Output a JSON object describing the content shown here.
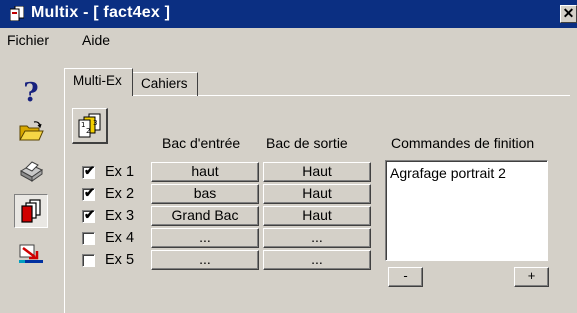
{
  "window": {
    "title": "Multix - [ fact4ex ]",
    "close_glyph": "✕",
    "titlebar_color": "#0b2f82"
  },
  "menu": {
    "items": [
      "Fichier",
      "Aide"
    ]
  },
  "toolbar": {
    "help_glyph": "?",
    "icons": [
      "help-icon",
      "open-folder-icon",
      "printer-icon",
      "multi-document-icon",
      "export-arrow-icon"
    ]
  },
  "tabs": [
    "Multi-Ex",
    "Cahiers"
  ],
  "columns": {
    "input_bin": "Bac d'entrée",
    "output_bin": "Bac de sortie",
    "finishing": "Commandes de finition"
  },
  "rows": [
    {
      "label": "Ex 1",
      "checked": true,
      "input_bin": "haut",
      "output_bin": "Haut"
    },
    {
      "label": "Ex 2",
      "checked": true,
      "input_bin": "bas",
      "output_bin": "Haut"
    },
    {
      "label": "Ex 3",
      "checked": true,
      "input_bin": "Grand Bac",
      "output_bin": "Haut"
    },
    {
      "label": "Ex 4",
      "checked": false,
      "input_bin": "...",
      "output_bin": "..."
    },
    {
      "label": "Ex 5",
      "checked": false,
      "input_bin": "...",
      "output_bin": "..."
    }
  ],
  "finishing": {
    "items": [
      "Agrafage portrait 2"
    ],
    "remove_label": "-",
    "add_label": "+"
  },
  "checkmark_glyph": "✔"
}
